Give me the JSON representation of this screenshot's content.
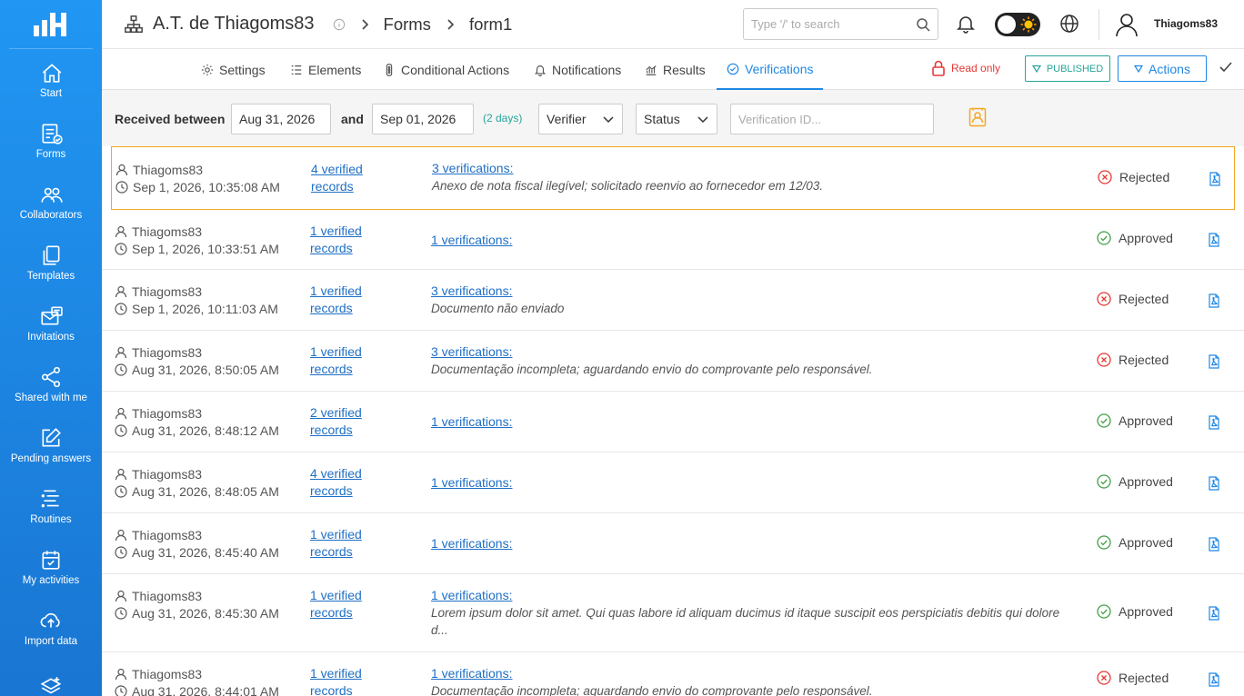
{
  "sidebar": {
    "items": [
      {
        "label": "Start",
        "icon": "home-icon"
      },
      {
        "label": "Forms",
        "icon": "form-icon"
      },
      {
        "label": "Collaborators",
        "icon": "users-icon"
      },
      {
        "label": "Templates",
        "icon": "copy-icon"
      },
      {
        "label": "Invitations",
        "icon": "mail-icon"
      },
      {
        "label": "Shared with me",
        "icon": "share-icon"
      },
      {
        "label": "Pending answers",
        "icon": "edit-icon"
      },
      {
        "label": "Routines",
        "icon": "list-icon"
      },
      {
        "label": "My activities",
        "icon": "calendar-check-icon"
      },
      {
        "label": "Import data",
        "icon": "cloud-upload-icon"
      },
      {
        "label": "",
        "icon": "layers-icon"
      }
    ]
  },
  "header": {
    "org_name": "A.T. de Thiagoms83",
    "breadcrumb_1": "Forms",
    "breadcrumb_2": "form1",
    "search_placeholder": "Type '/' to search",
    "username": "Thiagoms83"
  },
  "tabs": [
    {
      "label": "Settings",
      "icon": "gear-icon",
      "active": false
    },
    {
      "label": "Elements",
      "icon": "list-icon",
      "active": false
    },
    {
      "label": "Conditional Actions",
      "icon": "traffic-light-icon",
      "active": false
    },
    {
      "label": "Notifications",
      "icon": "bell-icon",
      "active": false
    },
    {
      "label": "Results",
      "icon": "chart-icon",
      "active": false
    },
    {
      "label": "Verifications",
      "icon": "check-circle-icon",
      "active": true
    }
  ],
  "toolbar": {
    "read_only": "Read only",
    "published": "PUBLISHED",
    "actions": "Actions"
  },
  "filters": {
    "received_between": "Received between",
    "date_from": "Aug 31, 2026",
    "and": "and",
    "date_to": "Sep 01, 2026",
    "days": "(2 days)",
    "verifier": "Verifier",
    "status": "Status",
    "verification_id_placeholder": "Verification ID..."
  },
  "rows": [
    {
      "user": "Thiagoms83",
      "time": "Sep 1, 2026, 10:35:08 AM",
      "records_1": "4 verified",
      "records_2": "records",
      "verifications": "3 verifications:",
      "note": "Anexo de nota fiscal ilegível; solicitado reenvio ao fornecedor em 12/03.",
      "status": "Rejected"
    },
    {
      "user": "Thiagoms83",
      "time": "Sep 1, 2026, 10:33:51 AM",
      "records_1": "1 verified",
      "records_2": "records",
      "verifications": "1 verifications:",
      "note": "",
      "status": "Approved"
    },
    {
      "user": "Thiagoms83",
      "time": "Sep 1, 2026, 10:11:03 AM",
      "records_1": "1 verified",
      "records_2": "records",
      "verifications": "3 verifications:",
      "note": "Documento não enviado",
      "status": "Rejected"
    },
    {
      "user": "Thiagoms83",
      "time": "Aug 31, 2026, 8:50:05 AM",
      "records_1": "1 verified",
      "records_2": "records",
      "verifications": "3 verifications:",
      "note": "Documentação incompleta; aguardando envio do comprovante pelo responsável.",
      "status": "Rejected"
    },
    {
      "user": "Thiagoms83",
      "time": "Aug 31, 2026, 8:48:12 AM",
      "records_1": "2 verified",
      "records_2": "records",
      "verifications": "1 verifications:",
      "note": "",
      "status": "Approved"
    },
    {
      "user": "Thiagoms83",
      "time": "Aug 31, 2026, 8:48:05 AM",
      "records_1": "4 verified",
      "records_2": "records",
      "verifications": "1 verifications:",
      "note": "",
      "status": "Approved"
    },
    {
      "user": "Thiagoms83",
      "time": "Aug 31, 2026, 8:45:40 AM",
      "records_1": "1 verified",
      "records_2": "records",
      "verifications": "1 verifications:",
      "note": "",
      "status": "Approved"
    },
    {
      "user": "Thiagoms83",
      "time": "Aug 31, 2026, 8:45:30 AM",
      "records_1": "1 verified",
      "records_2": "records",
      "verifications": "1 verifications:",
      "note": "Lorem ipsum dolor sit amet. Qui quas labore id aliquam ducimus id itaque suscipit eos perspiciatis debitis qui dolore d...",
      "status": "Approved"
    },
    {
      "user": "Thiagoms83",
      "time": "Aug 31, 2026, 8:44:01 AM",
      "records_1": "1 verified",
      "records_2": "records",
      "verifications": "1 verifications:",
      "note": "Documentação incompleta; aguardando envio do comprovante pelo responsável.",
      "status": "Rejected"
    }
  ],
  "colors": {
    "primary": "#1e88e5",
    "sidebar": "#2196f3",
    "approved": "#43a047",
    "rejected": "#e53935",
    "published": "#26a69a",
    "highlight": "#f5a623"
  }
}
